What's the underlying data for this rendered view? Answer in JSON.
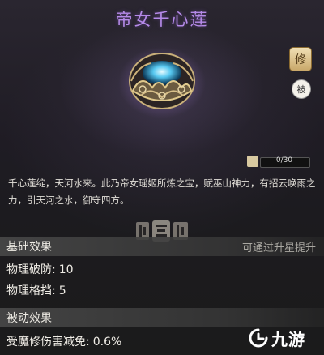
{
  "item": {
    "name": "帝女千心莲",
    "description": "千心莲绽，天河水来。此乃帝女瑶姬所炼之宝，赋巫山神力，有招云唤雨之力，引天河之水，御守四方。"
  },
  "side_buttons": {
    "upgrade_label": "修",
    "passive_label": "被"
  },
  "progress": {
    "text": "0/30",
    "current": 0,
    "max": 30
  },
  "basic_effects": {
    "title": "基础效果",
    "hint": "可通过升星提升",
    "stats": [
      {
        "label": "物理破防:",
        "value": "10"
      },
      {
        "label": "物理格挡:",
        "value": "5"
      }
    ]
  },
  "passive_effects": {
    "title": "被动效果",
    "stats": [
      {
        "label": "受魔修伤害减免:",
        "value": "0.6%"
      }
    ]
  },
  "watermark": {
    "text": "九游"
  },
  "colors": {
    "title": "#b58ae8",
    "accent": "#c9a86a"
  }
}
